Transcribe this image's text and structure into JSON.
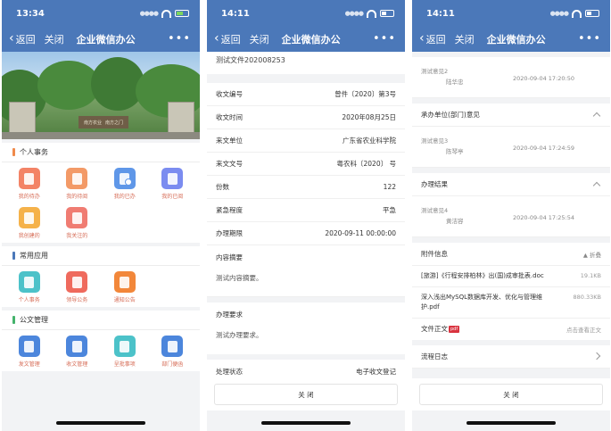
{
  "app": {
    "back_label": "返回",
    "close_label": "关闭",
    "title": "企业微信办公",
    "more_label": "•••"
  },
  "screen1": {
    "time": "13:34",
    "banner": {
      "sign_left": "南方农业",
      "sign_right": "南方之门"
    },
    "sections": [
      {
        "title": "个人事务",
        "color": "#f08a4b",
        "items": [
          {
            "label": "我的待办",
            "color": "#f38366",
            "icon": "todo-icon"
          },
          {
            "label": "我的待阅",
            "color": "#f39a67",
            "icon": "to-read-icon"
          },
          {
            "label": "我的已办",
            "color": "#5f97e8",
            "icon": "done-icon"
          },
          {
            "label": "我的已阅",
            "color": "#7b8cf0",
            "icon": "read-icon"
          },
          {
            "label": "我创建的",
            "color": "#f5b24a",
            "icon": "created-icon"
          },
          {
            "label": "我关注的",
            "color": "#f07c72",
            "icon": "followed-icon"
          }
        ]
      },
      {
        "title": "常用应用",
        "color": "#4b78b9",
        "items": [
          {
            "label": "个人事务",
            "color": "#4cc2c9",
            "icon": "personal-affairs-icon"
          },
          {
            "label": "领导公务",
            "color": "#ef6a5d",
            "icon": "leader-affairs-icon"
          },
          {
            "label": "通知公告",
            "color": "#f2873a",
            "icon": "notice-icon"
          }
        ]
      },
      {
        "title": "公文管理",
        "color": "#44b36c",
        "items": [
          {
            "label": "发文管理",
            "color": "#4c86dc",
            "icon": "outgoing-doc-icon"
          },
          {
            "label": "收文管理",
            "color": "#4c86dc",
            "icon": "incoming-doc-icon"
          },
          {
            "label": "呈批事项",
            "color": "#4cc2c9",
            "icon": "approval-icon"
          },
          {
            "label": "部门便函",
            "color": "#4c86dc",
            "icon": "dept-letter-icon"
          }
        ]
      }
    ]
  },
  "screen2": {
    "time": "14:11",
    "doc_title": "测试文件202008253",
    "fields": [
      {
        "label": "收文编号",
        "value": "曾件〔2020〕第3号"
      },
      {
        "label": "收文时间",
        "value": "2020年08月25日"
      },
      {
        "label": "来文单位",
        "value": "广东省农业科学院"
      },
      {
        "label": "来文文号",
        "value": "粤农科〔2020〕 号"
      },
      {
        "label": "份数",
        "value": "122"
      },
      {
        "label": "紧急程度",
        "value": "平急"
      },
      {
        "label": "办理期限",
        "value": "2020-09-11 00:00:00"
      }
    ],
    "summary_label": "内容摘要",
    "summary_text": "测试内容摘要。",
    "requirement_label": "办理要求",
    "requirement_text": "测试办理要求。",
    "status_label": "处理状态",
    "status_value": "电子收文登记",
    "close_button": "关 闭"
  },
  "screen3": {
    "time": "14:11",
    "opinion_top": {
      "text": "测试意见2",
      "name": "陆华忠",
      "time": "2020-09-04 17:20:50"
    },
    "dept_opinion_title": "承办单位(部门)意见",
    "dept_opinion": {
      "text": "测试意见3",
      "name": "陈琴亭",
      "time": "2020-09-04 17:24:59"
    },
    "result_title": "办理结果",
    "result": {
      "text": "测试意见4",
      "name": "黄洁容",
      "time": "2020-09-04 17:25:54"
    },
    "attach_title": "附件信息",
    "attach_fold": "▲ 折叠",
    "attachments": [
      {
        "name": "[旅游]《行程安排柏林》出(国)成审批表.doc",
        "size": "19.1KB"
      },
      {
        "name": "深入浅出MySQL数据库开发、优化与管理维护.pdf",
        "size": "880.33KB"
      }
    ],
    "body_label": "文件正文",
    "body_badge": "pdf",
    "body_link": "点击查看正文",
    "flow_log": "流程日志",
    "close_button": "关 闭"
  }
}
